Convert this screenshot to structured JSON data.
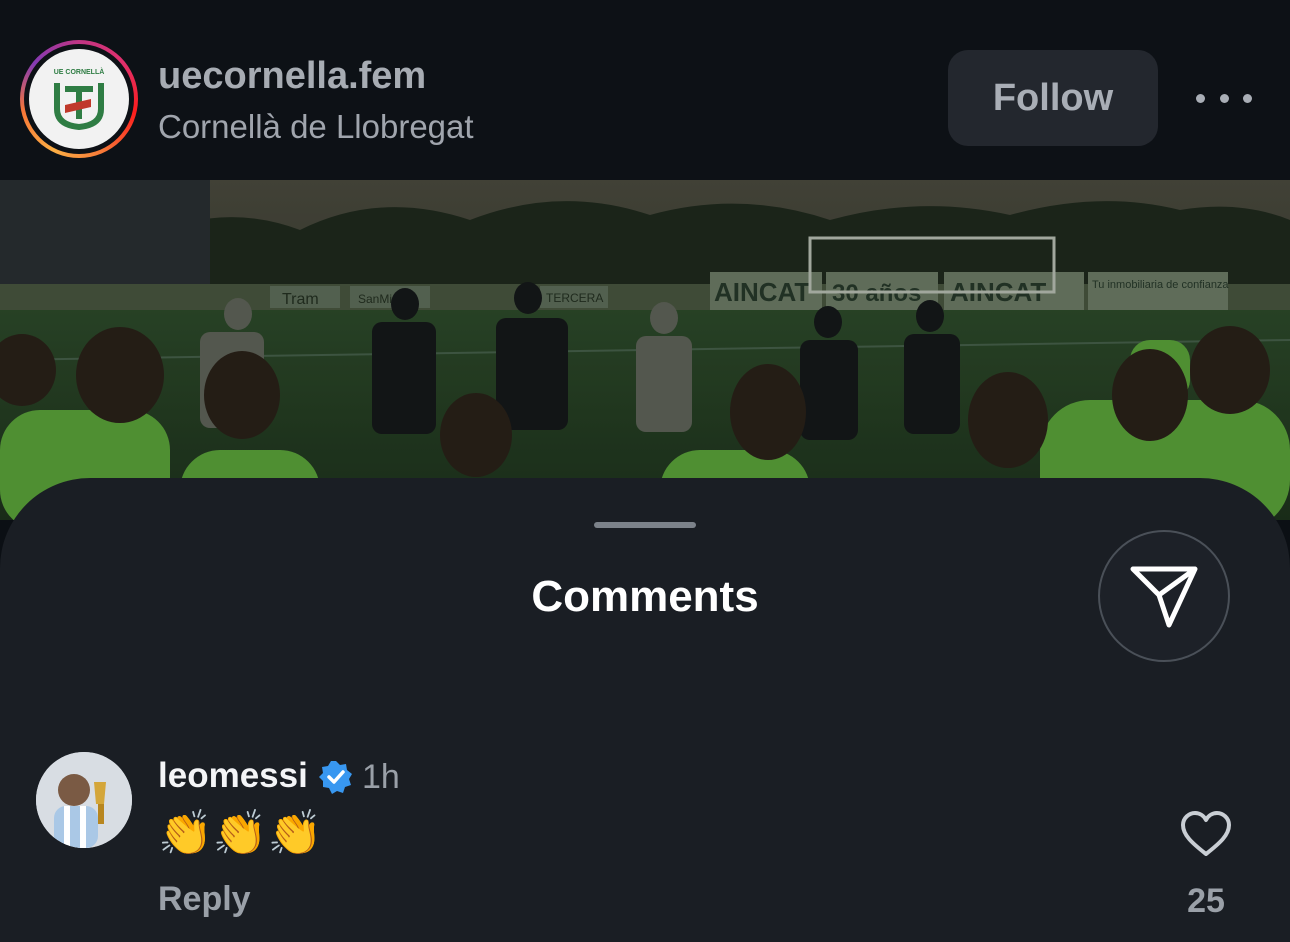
{
  "post_header": {
    "username": "uecornella.fem",
    "location": "Cornellà de Llobregat",
    "follow_label": "Follow",
    "avatar_caption": "UE CORNELLÀ"
  },
  "photo": {
    "signs": [
      "Tram",
      "SanMiguel",
      "TERCERA",
      "AINCAT",
      "30 años",
      "AINCAT",
      "Tu inmobiliaria de confianza"
    ]
  },
  "comments_sheet": {
    "title": "Comments",
    "comments": [
      {
        "username": "leomessi",
        "verified": true,
        "time": "1h",
        "text": "👏👏👏",
        "reply_label": "Reply",
        "like_count": "25"
      }
    ]
  },
  "colors": {
    "background": "#0b0f14",
    "sheet": "#1a1e24",
    "verified_badge": "#3897f0",
    "muted_text": "#9aa0a8"
  }
}
